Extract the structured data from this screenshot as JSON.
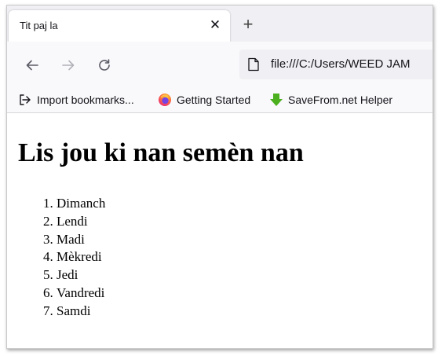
{
  "browser": {
    "tab_title": "Tit paj la",
    "url": "file:///C:/Users/WEED JAM",
    "bookmarks": [
      {
        "label": "Import bookmarks...",
        "icon": "import-icon"
      },
      {
        "label": "Getting Started",
        "icon": "firefox-icon"
      },
      {
        "label": "SaveFrom.net Helper",
        "icon": "savefrom-icon"
      }
    ]
  },
  "page": {
    "heading": "Lis jou ki nan semèn nan",
    "days": [
      "Dimanch",
      "Lendi",
      "Madi",
      "Mèkredi",
      "Jedi",
      "Vandredi",
      "Samdi"
    ]
  },
  "colors": {
    "tabstrip": "#f0f0f4",
    "toolbar": "#f9f9fb",
    "savefrom_green": "#4caf1f",
    "firefox_orange": "#ff7139"
  }
}
